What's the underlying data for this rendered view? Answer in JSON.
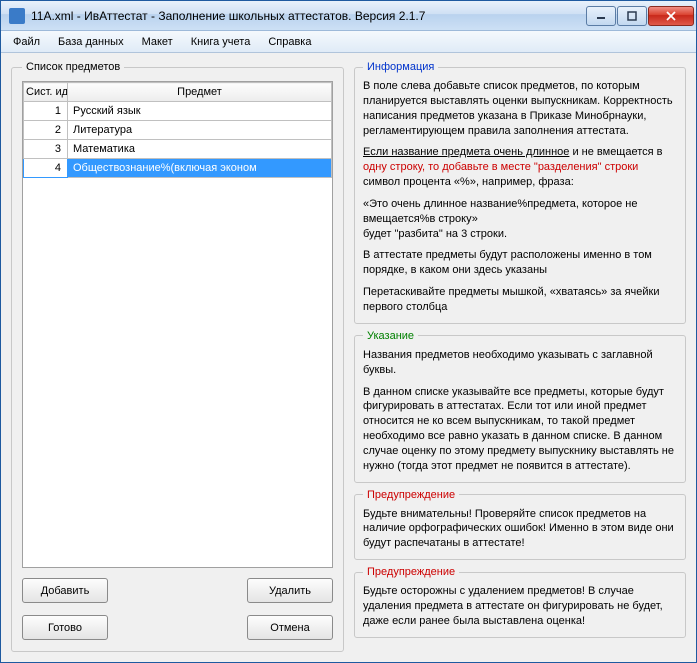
{
  "window": {
    "title": "11A.xml - ИвАттестат - Заполнение школьных аттестатов. Версия 2.1.7"
  },
  "menu": {
    "file": "Файл",
    "db": "База данных",
    "layout": "Макет",
    "book": "Книга учета",
    "help": "Справка"
  },
  "subjects": {
    "legend": "Список предметов",
    "col_id": "Сист. идент.",
    "col_name": "Предмет",
    "rows": [
      {
        "id": "1",
        "name": "Русский язык"
      },
      {
        "id": "2",
        "name": "Литература"
      },
      {
        "id": "3",
        "name": "Математика"
      },
      {
        "id": "4",
        "name": "Обществознание%(включая эконом"
      }
    ],
    "add": "Добавить",
    "del": "Удалить",
    "ok": "Готово",
    "cancel": "Отмена"
  },
  "info": {
    "legend": "Информация",
    "p1": "В поле слева добавьте список предметов, по которым планируется выставлять оценки выпускникам. Корректность написания предметов указана в Приказе Минобрнауки, регламентирующем правила заполнения аттестата.",
    "p2a": "Если название предмета очень длинное",
    "p2b": " и не вмещается в ",
    "p2c": "одну строку, то добавьте в месте \"разделения\" строки",
    "p2d": " символ процента «%», например, фраза:",
    "p3": "«Это очень длинное название%предмета, которое не вмещается%в строку»",
    "p4": "будет \"разбита\" на 3 строки.",
    "p5": "В аттестате предметы будут расположены именно в том порядке, в каком они здесь указаны",
    "p6": "Перетаскивайте предметы мышкой, «хватаясь» за ячейки первого столбца"
  },
  "note": {
    "legend": "Указание",
    "p1": "Названия предметов необходимо указывать с заглавной буквы.",
    "p2": "В данном списке указывайте все предметы, которые будут фигурировать в аттестатах. Если тот или иной предмет относится не ко всем выпускникам, то такой предмет необходимо все равно указать в данном списке. В данном случае оценку по этому предмету выпускнику выставлять не нужно (тогда этот предмет не появится в аттестате)."
  },
  "warn1": {
    "legend": "Предупреждение",
    "p1": "Будьте внимательны! Проверяйте список предметов на наличие орфографических ошибок! Именно в этом виде они будут распечатаны в аттестате!"
  },
  "warn2": {
    "legend": "Предупреждение",
    "p1": "Будьте осторожны с удалением предметов! В случае удаления предмета в аттестате он фигурировать не будет, даже если ранее была выставлена оценка!"
  }
}
